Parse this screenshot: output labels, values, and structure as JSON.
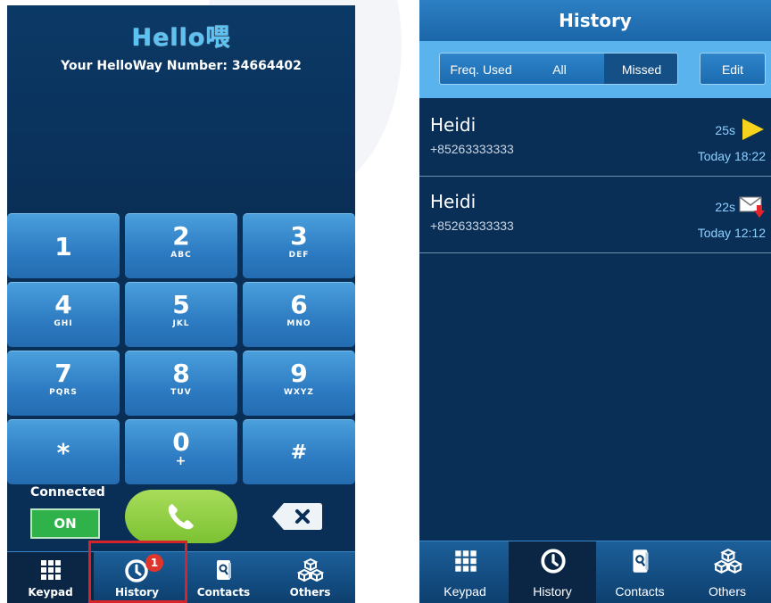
{
  "left": {
    "logo": "Hello喂",
    "number_line": "Your HelloWay Number: 34664402",
    "keys": [
      {
        "digit": "1",
        "letters": ""
      },
      {
        "digit": "2",
        "letters": "ABC"
      },
      {
        "digit": "3",
        "letters": "DEF"
      },
      {
        "digit": "4",
        "letters": "GHI"
      },
      {
        "digit": "5",
        "letters": "JKL"
      },
      {
        "digit": "6",
        "letters": "MNO"
      },
      {
        "digit": "7",
        "letters": "PQRS"
      },
      {
        "digit": "8",
        "letters": "TUV"
      },
      {
        "digit": "9",
        "letters": "WXYZ"
      },
      {
        "digit": "*",
        "letters": ""
      },
      {
        "digit": "0",
        "letters": "+"
      },
      {
        "digit": "#",
        "letters": ""
      }
    ],
    "connected_label": "Connected",
    "toggle_label": "ON",
    "tabs": [
      {
        "label": "Keypad",
        "icon": "grid-icon"
      },
      {
        "label": "History",
        "icon": "clock-icon"
      },
      {
        "label": "Contacts",
        "icon": "contacts-book-icon"
      },
      {
        "label": "Others",
        "icon": "cubes-icon"
      }
    ],
    "badge_count": "1",
    "active_tab": "Keypad"
  },
  "right": {
    "title": "History",
    "filters": [
      "Freq. Used",
      "All",
      "Missed"
    ],
    "selected_filter": "Missed",
    "edit_label": "Edit",
    "entries": [
      {
        "name": "Heidi",
        "number": "+85263333333",
        "duration": "25s",
        "time": "Today 18:22",
        "icon": "play-icon"
      },
      {
        "name": "Heidi",
        "number": "+85263333333",
        "duration": "22s",
        "time": "Today 12:12",
        "icon": "voicemail-envelope-icon"
      }
    ],
    "tabs": [
      {
        "label": "Keypad",
        "icon": "grid-icon"
      },
      {
        "label": "History",
        "icon": "clock-icon"
      },
      {
        "label": "Contacts",
        "icon": "contacts-book-icon"
      },
      {
        "label": "Others",
        "icon": "cubes-icon"
      }
    ],
    "active_tab": "History"
  },
  "colors": {
    "background_navy": "#0a2f57",
    "key_blue": "#2d7bc2",
    "call_green": "#7cc232",
    "toggle_green": "#2fb24a",
    "highlight_red": "#d7242b",
    "badge_red": "#e0352b",
    "accent_light_blue": "#5ab3ec"
  }
}
